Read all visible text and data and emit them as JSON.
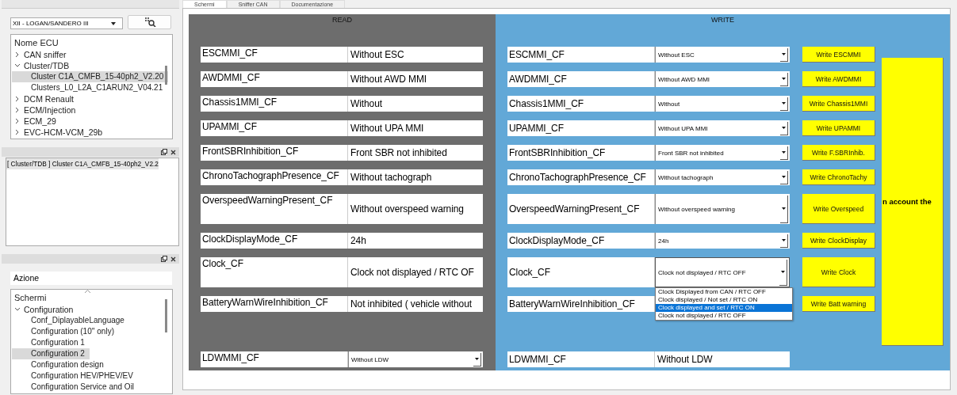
{
  "sidebar": {
    "vehicle_combo": {
      "value": "XII - LOGAN/SANDERO III"
    },
    "ecu_tree": {
      "header": "Nome ECU",
      "items": [
        {
          "label": "CAN sniffer",
          "expanded": false,
          "selected": false
        },
        {
          "label": "Cluster/TDB",
          "expanded": true,
          "selected": false,
          "children": [
            {
              "label": "Cluster C1A_CMFB_15-40ph2_V2.20",
              "selected": true
            },
            {
              "label": "Clusters_L0_L2A_C1ARUN2_V04.21",
              "selected": false
            }
          ]
        },
        {
          "label": "DCM Renault",
          "expanded": false,
          "selected": false
        },
        {
          "label": "ECM/Injection",
          "expanded": false,
          "selected": false
        },
        {
          "label": "ECM_29",
          "expanded": false,
          "selected": false
        },
        {
          "label": "EVC-HCM-VCM_29b",
          "expanded": false,
          "selected": false
        }
      ]
    },
    "selected_ecu_list": {
      "items": [
        "[ Cluster/TDB ] Cluster C1A_CMFB_15-40ph2_V2.2"
      ]
    },
    "action_panel": {
      "title": "Azione",
      "tree": {
        "header": "Schermi",
        "items": [
          {
            "label": "Configuration",
            "expanded": true,
            "selected": false,
            "children": [
              {
                "label": "Conf_DiplayableLanguage",
                "selected": false
              },
              {
                "label": "Configuration (10'' only)",
                "selected": false
              },
              {
                "label": "Configuration 1",
                "selected": false
              },
              {
                "label": "Configuration 2",
                "selected": true
              },
              {
                "label": "Configuration design",
                "selected": false
              },
              {
                "label": "Configuration HEV/PHEV/EV",
                "selected": false
              },
              {
                "label": "Configuration Service and Oil",
                "selected": false
              }
            ]
          }
        ]
      }
    }
  },
  "tabs": [
    {
      "label": "Schermi",
      "selected": true
    },
    {
      "label": "Sniffer CAN",
      "selected": false
    },
    {
      "label": "Documentazione",
      "selected": false
    }
  ],
  "read_panel": {
    "title": "READ"
  },
  "write_panel": {
    "title": "WRITE",
    "side_note": "n account the"
  },
  "rows": [
    {
      "read_label": "ESCMMI_CF",
      "read_value": "Without ESC",
      "write_label": "ESCMMI_CF",
      "write_value": "Without ESC",
      "button": "Write ESCMMI",
      "tall": false
    },
    {
      "read_label": "AWDMMI_CF",
      "read_value": "Without AWD MMI",
      "write_label": "AWDMMI_CF",
      "write_value": "Without AWD MMI",
      "button": "Write AWDMMI",
      "tall": false
    },
    {
      "read_label": "Chassis1MMI_CF",
      "read_value": "Without",
      "write_label": "Chassis1MMI_CF",
      "write_value": "Without",
      "button": "Write Chassis1MMI",
      "tall": false
    },
    {
      "read_label": "UPAMMI_CF",
      "read_value": "Without UPA MMI",
      "write_label": "UPAMMI_CF",
      "write_value": "Without UPA MMI",
      "button": "Write UPAMMI",
      "tall": false
    },
    {
      "read_label": "FrontSBRInhibition_CF",
      "read_value": "Front SBR not inhibited",
      "write_label": "FrontSBRInhibition_CF",
      "write_value": "Front SBR not inhibited",
      "button": "Write F.SBRInhib.",
      "tall": false
    },
    {
      "read_label": "ChronoTachographPresence_CF",
      "read_value": "Without tachograph",
      "write_label": "ChronoTachographPresence_CF",
      "write_value": "Without tachograph",
      "button": "Write ChronoTachy",
      "tall": false
    },
    {
      "read_label": "OverspeedWarningPresent_CF",
      "read_value": "Without overspeed warning",
      "write_label": "OverspeedWarningPresent_CF",
      "write_value": "Without overspeed warning",
      "button": "Write Overspeed",
      "tall": true
    },
    {
      "read_label": "ClockDisplayMode_CF",
      "read_value": "24h",
      "write_label": "ClockDisplayMode_CF",
      "write_value": "24h",
      "button": "Write ClockDisplay",
      "tall": false
    },
    {
      "read_label": "Clock_CF",
      "read_value": "Clock not displayed / RTC OF",
      "write_label": "Clock_CF",
      "write_value": "Clock not displayed / RTC OFF",
      "button": "Write Clock",
      "tall": true,
      "open_options": [
        {
          "label": "Clock Displayed from CAN / RTC OFF",
          "selected": false
        },
        {
          "label": "Clock displayed / Not set / RTC ON",
          "selected": false
        },
        {
          "label": "Clock displayed and set / RTC ON",
          "selected": true
        },
        {
          "label": "Clock not displayed / RTC OFF",
          "selected": false
        }
      ]
    },
    {
      "read_label": "BatteryWarnWireInhibition_CF",
      "read_value": "Not inhibited ( vehicle without",
      "write_label": "BatteryWarnWireInhibition_CF",
      "button": "Write Batt warning",
      "tall": false
    }
  ],
  "ldw_row": {
    "read_label": "LDWMMI_CF",
    "read_value": "Without LDW",
    "write_label": "LDWMMI_CF",
    "write_value": "Without LDW"
  }
}
